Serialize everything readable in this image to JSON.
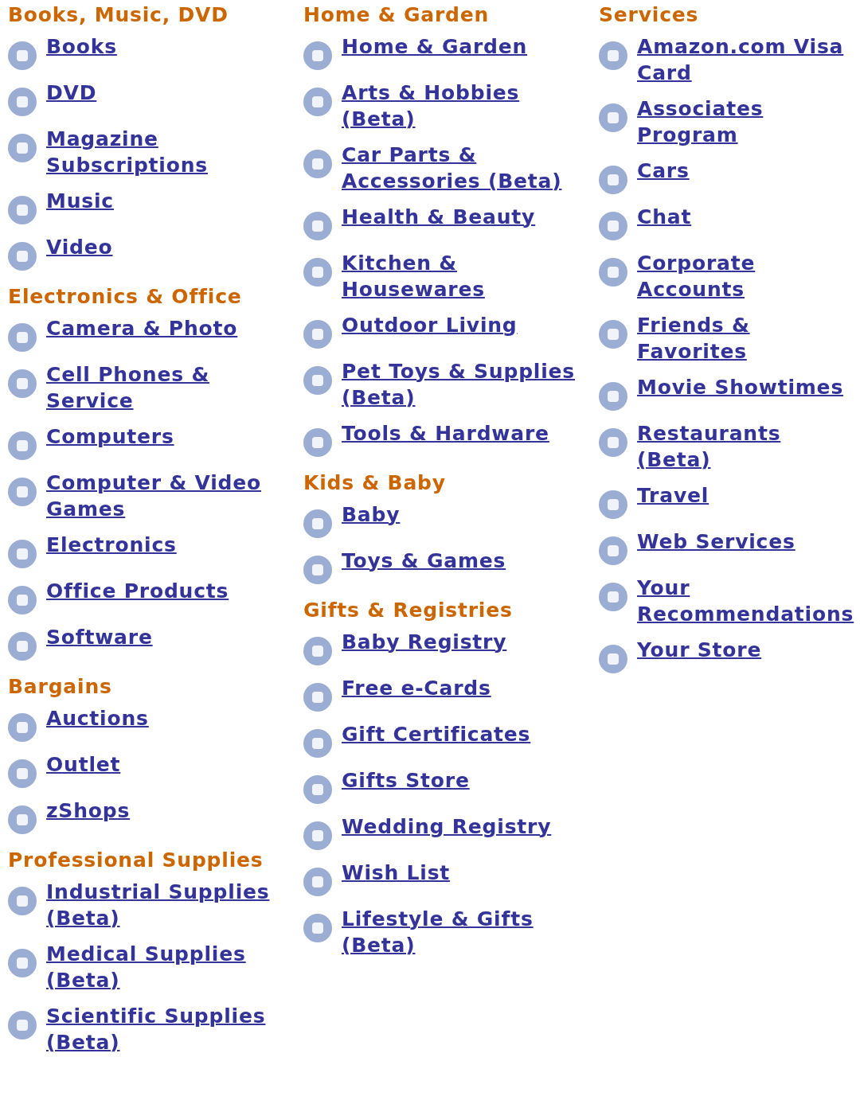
{
  "columns": [
    {
      "sections": [
        {
          "heading": "Books, Music, DVD",
          "links": [
            "Books",
            "DVD",
            "Magazine Subscriptions",
            "Music",
            "Video"
          ]
        },
        {
          "heading": "Electronics & Office",
          "links": [
            "Camera & Photo",
            "Cell Phones & Service",
            "Computers",
            "Computer & Video Games",
            "Electronics",
            "Office Products",
            "Software"
          ]
        },
        {
          "heading": "Bargains",
          "links": [
            "Auctions",
            "Outlet",
            "zShops"
          ]
        },
        {
          "heading": "Professional Supplies",
          "links": [
            "Industrial Supplies (Beta)",
            "Medical Supplies (Beta)",
            "Scientific Supplies (Beta)"
          ]
        }
      ]
    },
    {
      "sections": [
        {
          "heading": "Home & Garden",
          "links": [
            "Home & Garden",
            "Arts & Hobbies (Beta)",
            "Car Parts & Accessories (Beta)",
            "Health & Beauty",
            "Kitchen & Housewares",
            "Outdoor Living",
            "Pet Toys & Supplies (Beta)",
            "Tools & Hardware"
          ]
        },
        {
          "heading": "Kids & Baby",
          "links": [
            "Baby",
            "Toys & Games"
          ]
        },
        {
          "heading": "Gifts & Registries",
          "links": [
            "Baby Registry",
            "Free e-Cards",
            "Gift Certificates",
            "Gifts Store",
            "Wedding Registry",
            "Wish List",
            "Lifestyle & Gifts (Beta)"
          ]
        }
      ]
    },
    {
      "sections": [
        {
          "heading": "Services",
          "links": [
            "Amazon.com Visa Card",
            "Associates Program",
            "Cars",
            "Chat",
            "Corporate Accounts",
            "Friends & Favorites",
            "Movie Showtimes",
            "Restaurants (Beta)",
            "Travel",
            "Web Services",
            "Your Recommendations",
            "Your Store"
          ]
        }
      ]
    }
  ]
}
